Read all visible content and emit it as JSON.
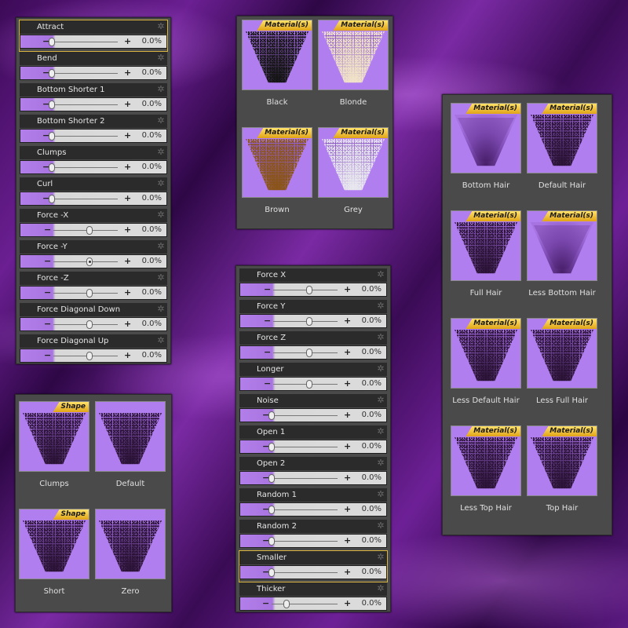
{
  "sliders_left": [
    {
      "label": "Attract",
      "value": "0.0%",
      "knob": "left"
    },
    {
      "label": "Bend",
      "value": "0.0%",
      "knob": "left"
    },
    {
      "label": "Bottom Shorter 1",
      "value": "0.0%",
      "knob": "left"
    },
    {
      "label": "Bottom Shorter 2",
      "value": "0.0%",
      "knob": "left"
    },
    {
      "label": "Clumps",
      "value": "0.0%",
      "knob": "left"
    },
    {
      "label": "Curl",
      "value": "0.0%",
      "knob": "left"
    },
    {
      "label": "Force -X",
      "value": "0.0%",
      "knob": "mid"
    },
    {
      "label": "Force -Y",
      "value": "0.0%",
      "knob": "mid"
    },
    {
      "label": "Force -Z",
      "value": "0.0%",
      "knob": "mid"
    },
    {
      "label": "Force Diagonal Down",
      "value": "0.0%",
      "knob": "mid"
    },
    {
      "label": "Force Diagonal Up",
      "value": "0.0%",
      "knob": "mid"
    }
  ],
  "sliders_mid": [
    {
      "label": "Force X",
      "value": "0.0%",
      "knob": "mid"
    },
    {
      "label": "Force Y",
      "value": "0.0%",
      "knob": "mid"
    },
    {
      "label": "Force Z",
      "value": "0.0%",
      "knob": "mid"
    },
    {
      "label": "Longer",
      "value": "0.0%",
      "knob": "mid"
    },
    {
      "label": "Noise",
      "value": "0.0%",
      "knob": "left"
    },
    {
      "label": "Open 1",
      "value": "0.0%",
      "knob": "left"
    },
    {
      "label": "Open 2",
      "value": "0.0%",
      "knob": "left"
    },
    {
      "label": "Random 1",
      "value": "0.0%",
      "knob": "left"
    },
    {
      "label": "Random 2",
      "value": "0.0%",
      "knob": "left"
    },
    {
      "label": "Smaller",
      "value": "0.0%",
      "knob": "left"
    },
    {
      "label": "Thicker",
      "value": "0.0%",
      "knob": "left2"
    }
  ],
  "controls": {
    "minus": "−",
    "plus": "+",
    "gear_icon": "gear-icon"
  },
  "materials_colors": [
    {
      "caption": "Black",
      "badge": "Material(s)",
      "color": "#141414"
    },
    {
      "caption": "Blonde",
      "badge": "Material(s)",
      "color": "#f1e3c8"
    },
    {
      "caption": "Brown",
      "badge": "Material(s)",
      "color": "#8a5418"
    },
    {
      "caption": "Grey",
      "badge": "Material(s)",
      "color": "#e8e8ee"
    }
  ],
  "shapes": [
    {
      "caption": "Clumps",
      "badge": "Shape",
      "color": "#2a1235"
    },
    {
      "caption": "Default",
      "badge": "",
      "color": "#2a1235"
    },
    {
      "caption": "Short",
      "badge": "Shape",
      "color": "#2a1235"
    },
    {
      "caption": "Zero",
      "badge": "",
      "color": "#2a1235"
    }
  ],
  "materials_hair": [
    {
      "caption": "Bottom Hair",
      "badge": "Material(s)",
      "style": "smooth"
    },
    {
      "caption": "Default Hair",
      "badge": "Material(s)",
      "style": "noise"
    },
    {
      "caption": "Full Hair",
      "badge": "Material(s)",
      "style": "noise"
    },
    {
      "caption": "Less Bottom Hair",
      "badge": "Material(s)",
      "style": "smooth"
    },
    {
      "caption": "Less Default Hair",
      "badge": "Material(s)",
      "style": "noise"
    },
    {
      "caption": "Less Full Hair",
      "badge": "Material(s)",
      "style": "noise"
    },
    {
      "caption": "Less Top Hair",
      "badge": "Material(s)",
      "style": "noise"
    },
    {
      "caption": "Top Hair",
      "badge": "Material(s)",
      "style": "noise"
    }
  ],
  "colors": {
    "accent_purple": "#b17ef0",
    "badge_gold": "#f3c53a",
    "panel": "#4a4a4a",
    "selected_outline": "#d8b540"
  }
}
